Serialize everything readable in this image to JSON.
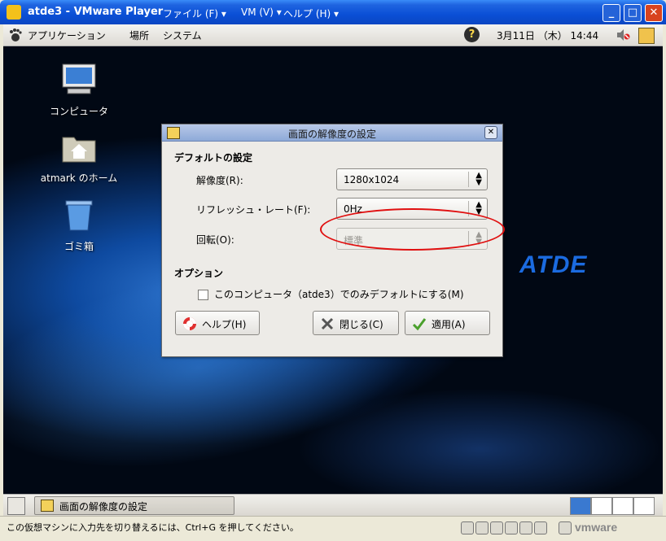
{
  "window": {
    "title": "atde3 - VMware Player",
    "menus": [
      "ファイル (F) ▾",
      "VM (V) ▾",
      "ヘルプ (H) ▾"
    ],
    "buttons": {
      "minimize": "_",
      "maximize": "□",
      "close": "✕"
    }
  },
  "top_panel": {
    "menus": [
      "アプリケーション",
      "場所",
      "システム"
    ],
    "clock": "3月11日 （木） 14:44"
  },
  "desktop": {
    "icons": [
      "コンピュータ",
      "atmark のホーム",
      "ゴミ箱"
    ],
    "logo": "ATDE"
  },
  "dialog": {
    "title": "画面の解像度の設定",
    "default_section": "デフォルトの設定",
    "resolution_label": "解像度(R):",
    "resolution_value": "1280x1024",
    "refresh_label": "リフレッシュ・レート(F):",
    "refresh_value": "0Hz",
    "rotation_label": "回転(O):",
    "rotation_value": "標準",
    "option_section": "オプション",
    "checkbox_label": "このコンピュータ（atde3）でのみデフォルトにする(M)",
    "help_button": "ヘルプ(H)",
    "close_button": "閉じる(C)",
    "apply_button": "適用(A)"
  },
  "bottom_panel": {
    "task_label": "画面の解像度の設定"
  },
  "status_bar": {
    "message": "この仮想マシンに入力先を切り替えるには、Ctrl+G を押してください。",
    "brand": "vmware"
  },
  "colors": {
    "title_bar": "#0a4fd6",
    "highlight_oval": "#e01010",
    "atde_logo": "#1b6be0"
  }
}
